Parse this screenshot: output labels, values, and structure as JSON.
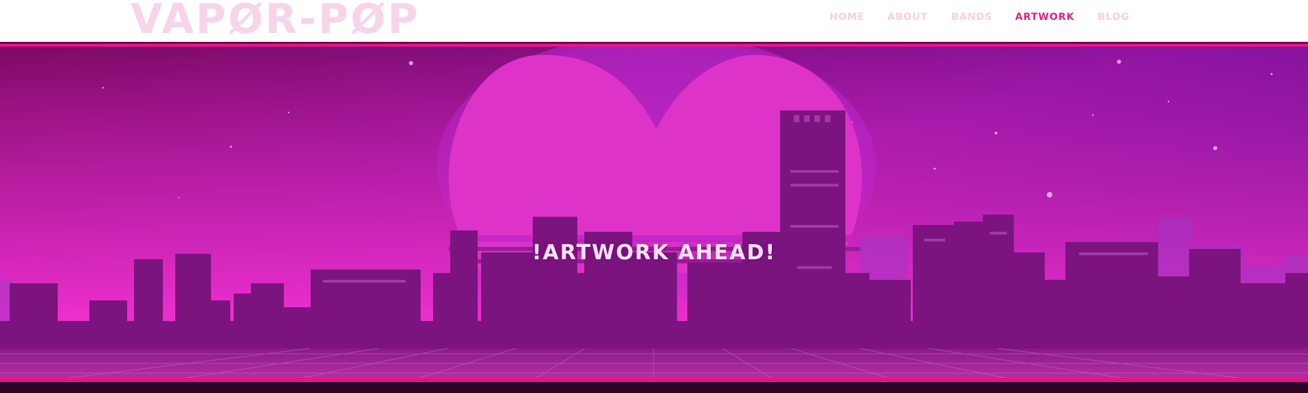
{
  "site": {
    "logo": "VAPØR-PØP"
  },
  "nav": {
    "items": [
      {
        "label": "HOME"
      },
      {
        "label": "ABOUT"
      },
      {
        "label": "BANDS"
      },
      {
        "label": "ARTWORK",
        "active": true
      },
      {
        "label": "BLOG"
      }
    ]
  },
  "hero": {
    "title": "!ARTWORK AHEAD!"
  },
  "colors": {
    "accent": "#e0217f",
    "nav_inactive": "#f6cfe4",
    "logo": "#f6d5ea",
    "sky_top": "#7a0a66",
    "sky_bottom": "#ee2fc0",
    "sun": "#dd33c8"
  }
}
